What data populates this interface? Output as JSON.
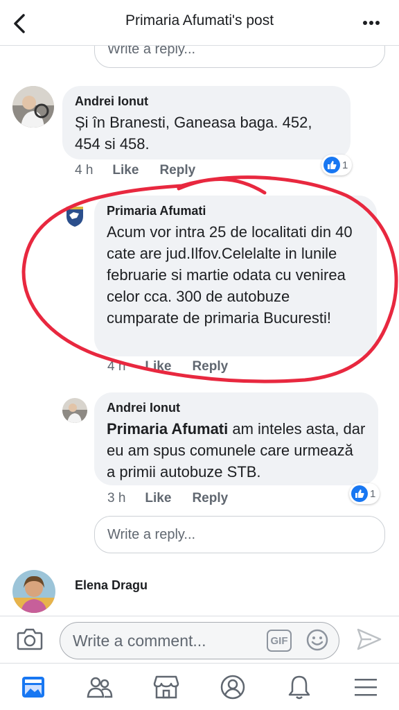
{
  "header": {
    "title": "Primaria Afumati's post",
    "back_icon": "chevron-left-icon",
    "more_icon": "more-dots-icon"
  },
  "reply_placeholder_top": "Write a reply...",
  "comments": [
    {
      "author": "Andrei Ionut",
      "text": "Și în Branesti, Ganeasa baga. 452, 454 si 458.",
      "time": "4 h",
      "like": "Like",
      "reply": "Reply",
      "reactions": "1"
    },
    {
      "author": "Primaria Afumati",
      "text": "Acum vor intra 25 de localitati din 40 cate are jud.Ilfov.Celelalte in lunile februarie si martie odata cu venirea celor cca. 300 de autobuze cumparate de primaria Bucuresti!",
      "time": "4 h",
      "like": "Like",
      "reply": "Reply"
    },
    {
      "author": "Andrei Ionut",
      "mention": "Primaria Afumati",
      "text": " am inteles asta, dar eu am spus comunele care urmează a primii autobuze STB.",
      "time": "3 h",
      "like": "Like",
      "reply": "Reply",
      "reactions": "1"
    }
  ],
  "reply_placeholder": "Write a reply...",
  "next_comment": {
    "author": "Elena Dragu"
  },
  "composer": {
    "placeholder": "Write a comment...",
    "gif_label": "GIF"
  },
  "colors": {
    "like_blue": "#1877f2",
    "annotation_red": "#e8283f",
    "bubble_grey": "#f0f2f5",
    "active_tab": "#1877f2"
  },
  "tabs": [
    "news-feed-icon",
    "friends-icon",
    "marketplace-icon",
    "profile-icon",
    "notifications-icon",
    "menu-icon"
  ]
}
